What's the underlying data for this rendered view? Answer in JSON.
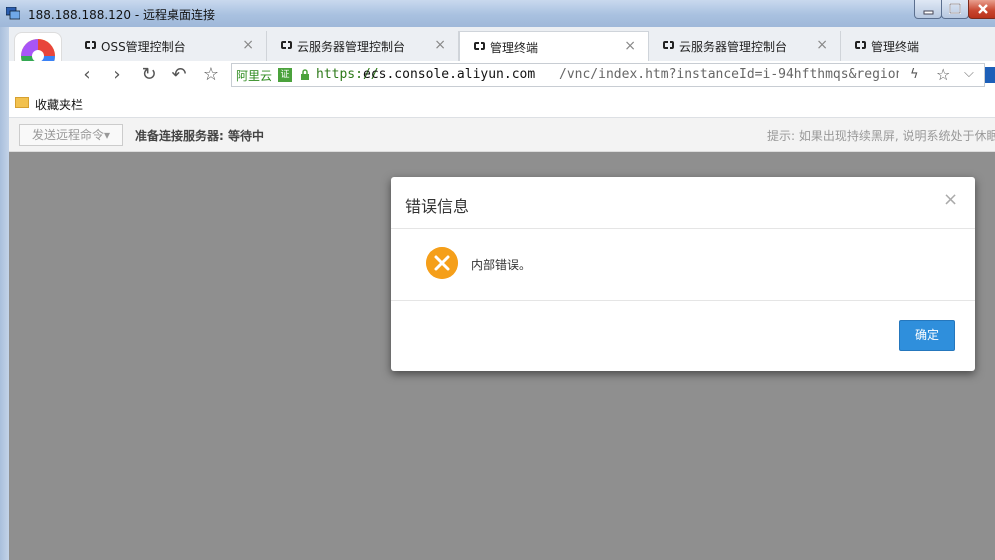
{
  "window": {
    "title": "188.188.188.120 - 远程桌面连接"
  },
  "browser": {
    "tabs": [
      {
        "label": "OSS管理控制台",
        "close": "×",
        "active": false
      },
      {
        "label": "云服务器管理控制台",
        "close": "×",
        "active": false
      },
      {
        "label": "管理终端",
        "close": "×",
        "active": true
      },
      {
        "label": "云服务器管理控制台",
        "close": "×",
        "active": false
      },
      {
        "label": "管理终端",
        "close": "",
        "active": false
      }
    ],
    "address": {
      "brand": "阿里云",
      "cert_badge": "证",
      "scheme": "https://",
      "host": "ecs.console.aliyun.com",
      "path": "/vnc/index.htm?instanceId=i-94hfthmqs&regionI"
    },
    "bookmarks_label": "收藏夹栏"
  },
  "vnc_toolbar": {
    "send_command": "发送远程命令▾",
    "status": "准备连接服务器: 等待中",
    "hint": "提示: 如果出现持续黑屏, 说明系统处于休眠"
  },
  "modal": {
    "title": "错误信息",
    "close": "×",
    "message": "内部错误。",
    "ok_label": "确定"
  },
  "colors": {
    "accent_blue": "#2f8fdc",
    "error_orange": "#f59f1a",
    "overlay_gray": "#8f8f8f"
  }
}
